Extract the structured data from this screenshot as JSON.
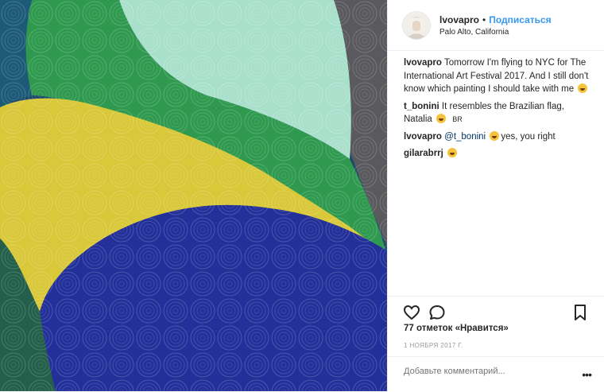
{
  "post": {
    "username": "lvovapro",
    "separator": "•",
    "follow_label": "Подписаться",
    "location": "Palo Alto, California",
    "image_icon": "painting-image"
  },
  "comments": [
    {
      "user": "lvovapro",
      "text": "Tomorrow I'm flying to NYC for The International Art Festival 2017. And I still don't know which painting I should take with me",
      "emoji": "thinking-face"
    },
    {
      "user": "t_bonini",
      "text": "It resembles the Brazilian flag, Natalia",
      "emoji": "grinning-face",
      "suffix": "BR"
    },
    {
      "user": "lvovapro",
      "mention": "@t_bonini",
      "text": "yes, you right",
      "emoji": "grinning-face"
    },
    {
      "user": "gilarabrrj",
      "text": "",
      "emoji": "heart-eyes-face"
    }
  ],
  "actions": {
    "like_icon": "heart-icon",
    "comment_icon": "comment-icon",
    "save_icon": "bookmark-icon"
  },
  "likes": "77 отметок «Нравится»",
  "date": "1 НОЯБРЯ 2017 Г.",
  "add_comment": {
    "placeholder": "Добавьте комментарий...",
    "more_label": "•••"
  }
}
